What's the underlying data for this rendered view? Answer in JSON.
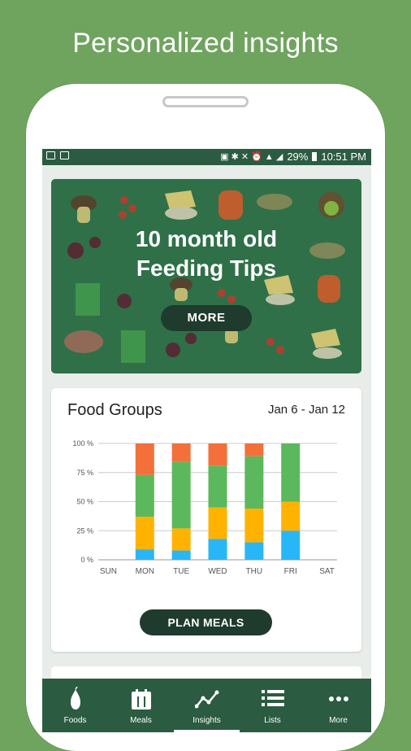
{
  "headline": "Personalized insights",
  "status_bar": {
    "battery": "29%",
    "time": "10:51 PM"
  },
  "banner": {
    "title_line1": "10 month old",
    "title_line2": "Feeding Tips",
    "more_label": "MORE"
  },
  "food_groups_card": {
    "title": "Food Groups",
    "date_range": "Jan 6 - Jan 12",
    "plan_button_label": "PLAN MEALS"
  },
  "chart_data": {
    "type": "bar",
    "stacked": true,
    "categories": [
      "SUN",
      "MON",
      "TUE",
      "WED",
      "THU",
      "FRI",
      "SAT"
    ],
    "yticks": [
      "0 %",
      "25 %",
      "50 %",
      "75 %",
      "100 %"
    ],
    "ylim": [
      0,
      100
    ],
    "series": [
      {
        "color": "#29b6f6",
        "values": [
          0,
          9,
          8,
          18,
          15,
          25,
          0
        ]
      },
      {
        "color": "#ffb300",
        "values": [
          0,
          28,
          19,
          27,
          29,
          25,
          0
        ]
      },
      {
        "color": "#5cb85c",
        "values": [
          0,
          36,
          57,
          36,
          45,
          50,
          0
        ]
      },
      {
        "color": "#f4703a",
        "values": [
          0,
          27,
          16,
          19,
          11,
          0,
          0
        ]
      }
    ],
    "grid": true
  },
  "bottom_nav": [
    {
      "label": "Foods",
      "icon": "pear-icon"
    },
    {
      "label": "Meals",
      "icon": "calendar-fork-icon"
    },
    {
      "label": "Insights",
      "icon": "trend-line-icon",
      "active": true
    },
    {
      "label": "Lists",
      "icon": "list-icon"
    },
    {
      "label": "More",
      "icon": "more-dots-icon"
    }
  ],
  "colors": {
    "background": "#6fa45f",
    "app_dark_green": "#2b5b41",
    "banner_green": "#2f7048",
    "button_dark": "#1f3b2d"
  }
}
